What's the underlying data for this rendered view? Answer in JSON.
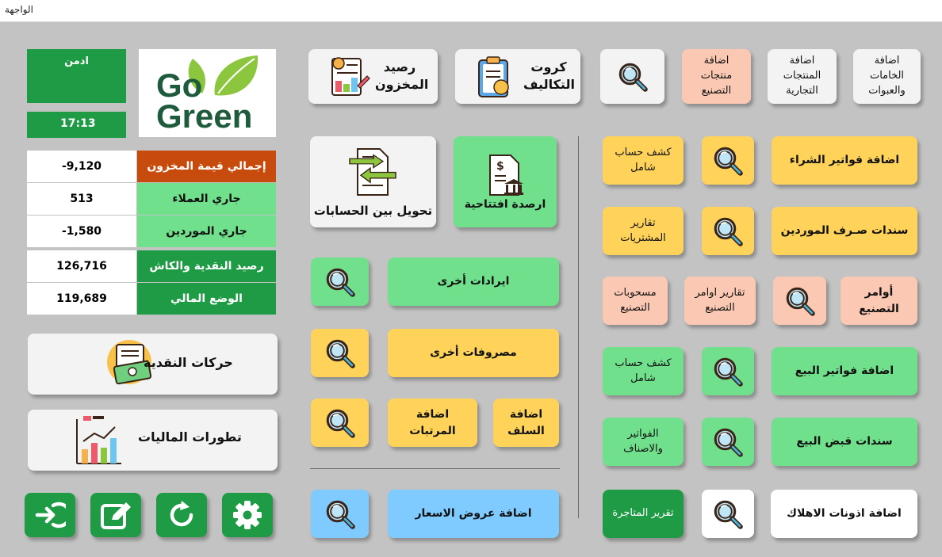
{
  "window": {
    "title": "الواجهة"
  },
  "user": {
    "name": "ادمن",
    "time": "17:13"
  },
  "logo": {
    "line1": "Go",
    "line2": "Green"
  },
  "stats": [
    {
      "label": "إجمالي قيمة المخزون",
      "value": "-9,120",
      "color": "#c84b0e"
    },
    {
      "label": "جاري العملاء",
      "value": "513",
      "color": "#71e08d"
    },
    {
      "label": "جاري الموردين",
      "value": "-1,580",
      "color": "#71e08d"
    },
    {
      "label": "رصيد النقدية والكاش",
      "value": "126,716",
      "color": "#1f9b45"
    },
    {
      "label": "الوضع المالي",
      "value": "119,689",
      "color": "#1f9b45"
    }
  ],
  "left_buttons": {
    "cash_movements": "حركات النقدية",
    "financial_trends": "تطورات الماليات"
  },
  "bottom_icons": [
    "logout-icon",
    "edit-icon",
    "refresh-icon",
    "settings-icon"
  ],
  "top_row": {
    "inventory_balance": "رصيد المخزون",
    "cost_cards": "كروت التكاليف",
    "add_manufacturing_products": "اضافة منتجات التصنيع",
    "add_trade_products": "اضافة المنتجات التجارية",
    "add_raw_materials": "اضافة الخامات والعبوات"
  },
  "middle": {
    "account_transfer": "تحويل بين الحسابات",
    "opening_balances": "ارصدة افتتاحية",
    "other_revenues": "ايرادات أخرى",
    "other_expenses": "مصروفات أخرى",
    "add_salaries": "اضافة المرتبات",
    "add_advances": "اضافة السلف",
    "add_price_offers": "اضافة عروض الاسعار"
  },
  "right": {
    "add_purchase_invoices": "اضافة فواتير الشراء",
    "full_statement_1": "كشف حساب شامل",
    "supplier_payments": "سندات صـرف الموردين",
    "purchase_reports": "تقارير المشتريات",
    "manufacturing_orders": "أوامر التصنيع",
    "manufacturing_orders_reports": "تقارير اوامر التصنيع",
    "manufacturing_withdrawals": "مسحوبات التصنيع",
    "add_sales_invoices": "اضافة فواتير البيع",
    "full_statement_2": "كشف حساب شامل",
    "sales_receipts": "سندات قبض البيع",
    "invoices_and_items": "الفواتير والاصناف",
    "add_scrap_permits": "اضافة اذونات الاهلاك",
    "trading_report": "تقرير المتاجرة"
  },
  "colors": {
    "background": "#c3c3c3",
    "yellow": "#ffd35a",
    "green": "#71e08d",
    "dark_green": "#1f9b45",
    "peach": "#fbc9b3",
    "blue": "#7fcbff",
    "orange_red": "#c84b0e"
  }
}
